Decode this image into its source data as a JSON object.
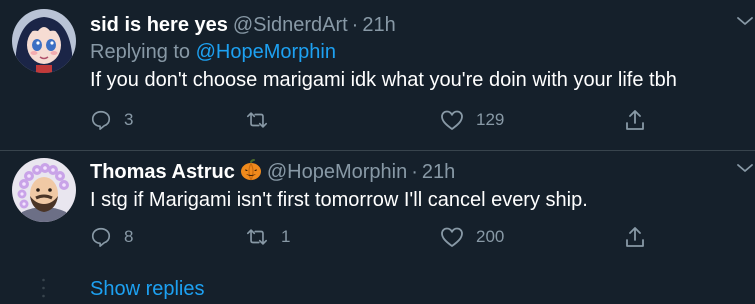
{
  "tweets": [
    {
      "name": "sid is here yes",
      "handle": "@SidnerdArt",
      "separator": "·",
      "time": "21h",
      "replying_prefix": "Replying to ",
      "replying_to": "@HopeMorphin",
      "text": "If you don't choose marigami idk what you're doin with your life tbh",
      "replies": "3",
      "retweets": "",
      "likes": "129",
      "avatar_icon": "anime-girl-avatar"
    },
    {
      "name": "Thomas Astruc",
      "name_emoji": "pumpkin-icon",
      "handle": "@HopeMorphin",
      "separator": "·",
      "time": "21h",
      "text": "I stg if Marigami isn't first tomorrow I'll cancel every ship.",
      "replies": "8",
      "retweets": "1",
      "likes": "200",
      "avatar_icon": "flower-crown-avatar"
    }
  ],
  "show_replies_label": "Show replies",
  "colors": {
    "background": "#15202b",
    "secondary_text": "#8899a6",
    "link": "#1da1f2",
    "divider": "#38444d"
  }
}
